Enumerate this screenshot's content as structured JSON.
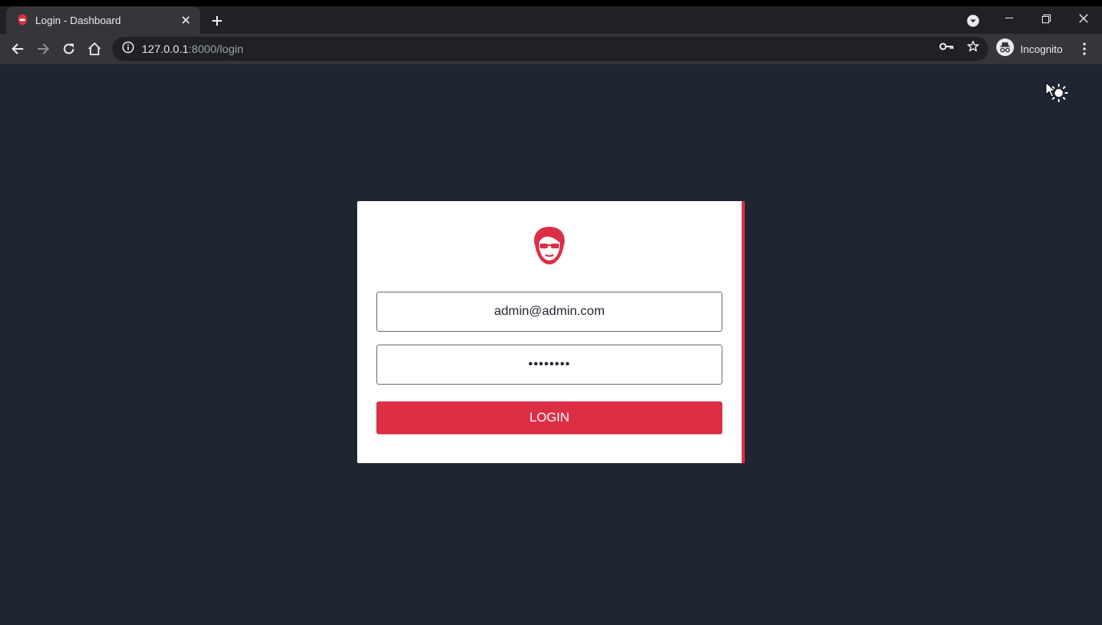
{
  "browser": {
    "tab_title": "Login - Dashboard",
    "url_host": "127.0.0.1",
    "url_path": ":8000/login",
    "incognito_label": "Incognito"
  },
  "login": {
    "email_value": "admin@admin.com",
    "password_value": "••••••••",
    "login_button_label": "LOGIN"
  },
  "colors": {
    "accent": "#dc2f45",
    "page_background": "#1f2532",
    "card_background": "#ffffff"
  },
  "icons": {
    "logo": "avatar-sunglasses-logo-icon",
    "theme_toggle": "sun-icon"
  }
}
